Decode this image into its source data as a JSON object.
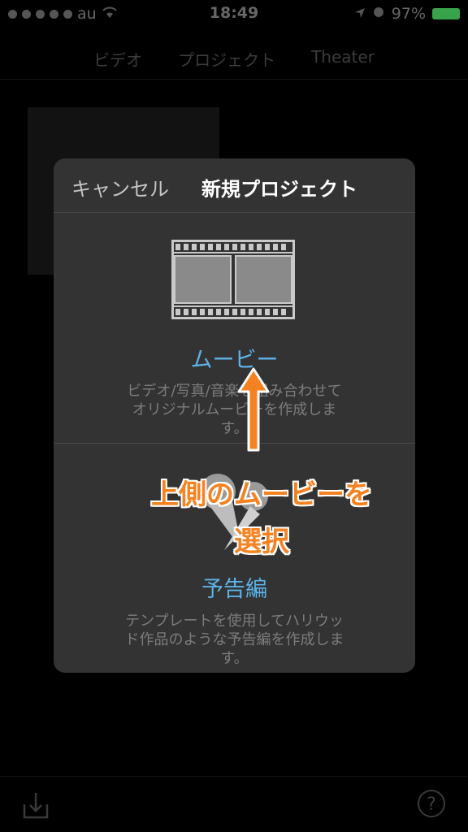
{
  "status_bar": {
    "carrier": "au",
    "time": "18:49",
    "battery": "97%"
  },
  "top_nav": {
    "tabs": [
      "ビデオ",
      "プロジェクト",
      "Theater"
    ]
  },
  "modal": {
    "cancel_label": "キャンセル",
    "title": "新規プロジェクト",
    "movie": {
      "title": "ムービー",
      "desc_line1": "ビデオ/写真/音楽を組み合わせて",
      "desc_line2": "オリジナルムービーを作成しま",
      "desc_line3": "す。"
    },
    "trailer": {
      "title": "予告編",
      "desc_line1": "テンプレートを使用してハリウッ",
      "desc_line2": "ド作品のような予告編を作成しま",
      "desc_line3": "す。"
    }
  },
  "annotation": {
    "line1": "上側のムービーを",
    "line2": "選択",
    "color": "#f58220"
  },
  "bottom_bar": {
    "help_label": "?"
  },
  "icons": [
    "wifi-icon",
    "location-icon",
    "alarm-icon",
    "film-strip-icon",
    "trailer-icon",
    "import-icon",
    "help-icon",
    "arrow-up-icon"
  ]
}
